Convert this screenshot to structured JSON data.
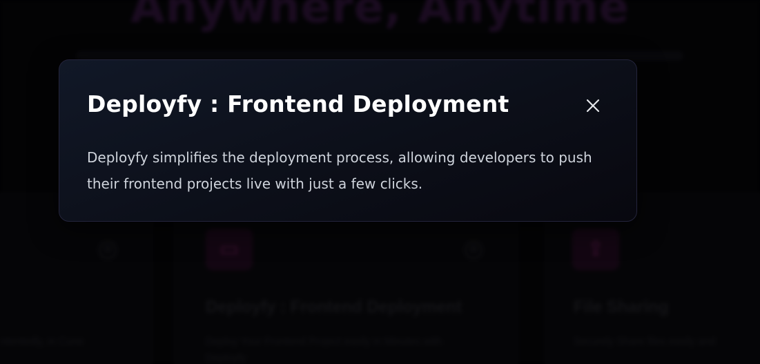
{
  "background": {
    "hero_title": "Anywhere, Anytime",
    "cards": [
      {
        "title": "",
        "description": "ntentedly, in Cune"
      },
      {
        "title": "Deployfy : Frontend Deployment",
        "description": "Deploy Your Frontend Project easily in Minutes with Deployfy"
      },
      {
        "title": "File Sharing",
        "description": "Securely Share files easily and"
      }
    ]
  },
  "modal": {
    "title": "Deployfy : Frontend Deployment",
    "description": "Deployfy simplifies the deployment process, allowing developers to push their frontend projects live with just a few clicks.",
    "close_icon": "close-icon"
  },
  "colors": {
    "modal_bg": "#111827",
    "modal_border": "#24243c",
    "modal_title": "#ffffff",
    "modal_text": "#cfd4dc",
    "accent_muted": "#2a1233"
  }
}
